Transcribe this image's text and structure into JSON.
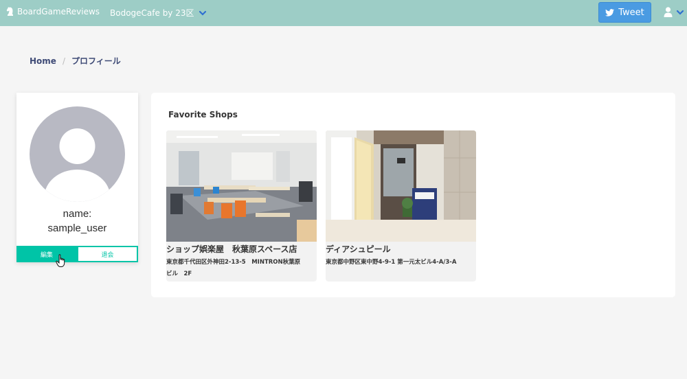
{
  "navbar": {
    "brand_icon": "chess-knight-icon",
    "brand": "BoardGameReviews",
    "nav_item": "BodogeCafe by 23区",
    "tweet_label": "Tweet",
    "tweet_icon": "twitter-bird-icon",
    "user_icon": "user-icon",
    "background": "#9dcdc6"
  },
  "breadcrumb": {
    "home": "Home",
    "separator": "/",
    "current": "プロフィール"
  },
  "profile": {
    "avatar_icon": "default-avatar-icon",
    "name_line1": "name:",
    "name_line2": "sample_user",
    "edit_label": "編集",
    "leave_label": "退会",
    "accent": "#00c4a7"
  },
  "favorites": {
    "title": "Favorite Shops",
    "shops": [
      {
        "name": "ショップ娯楽屋　秋葉原スペース店",
        "address_line1": "東京都千代田区外神田2-13-5　MINTRON秋葉原",
        "address_line2": "ビル　2F",
        "photo": "cafe-room-photo"
      },
      {
        "name": "ディアシュピール",
        "address_line1": "東京都中野区東中野4-9-1 第一元太ビル4-A/3-A",
        "photo": "cafe-entrance-photo"
      }
    ]
  }
}
